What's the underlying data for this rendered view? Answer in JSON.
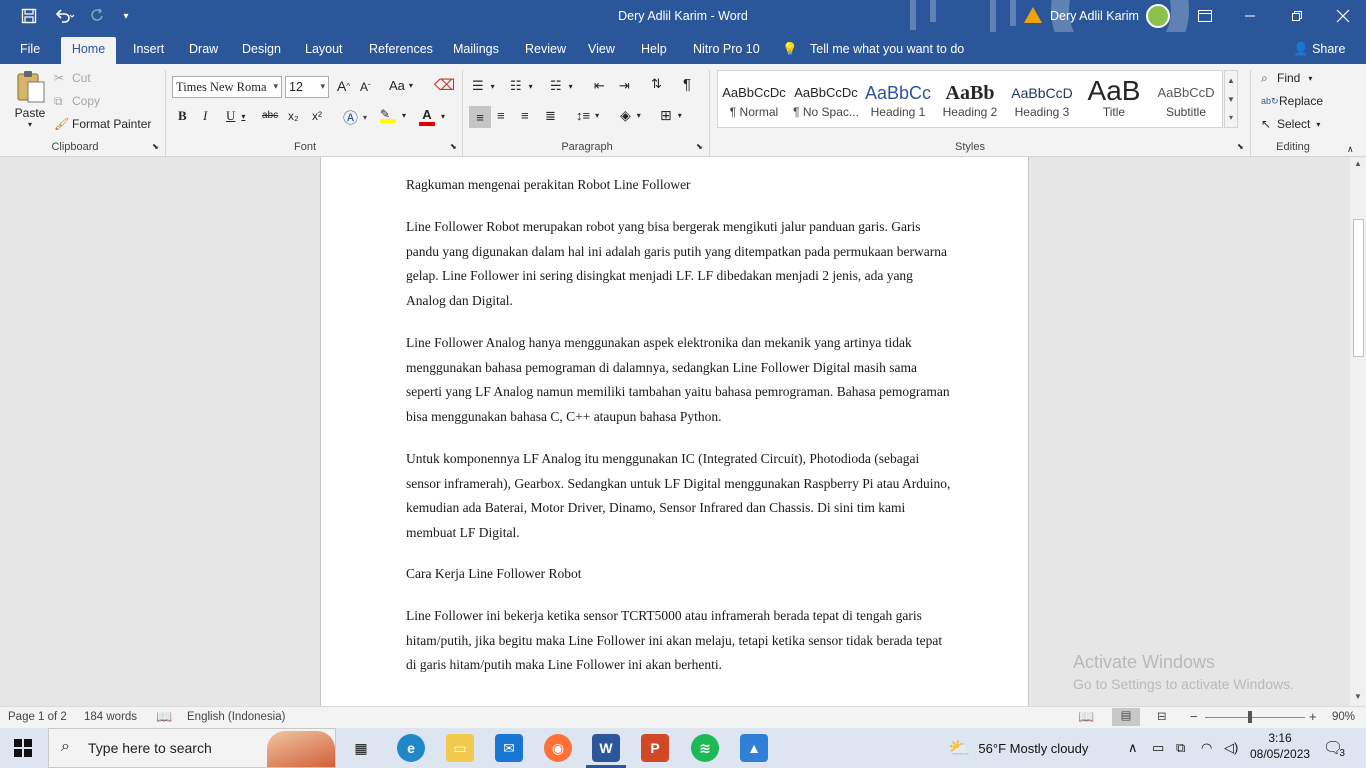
{
  "titlebar": {
    "title": "Dery Adlil Karim  -  Word",
    "user": "Dery Adlil Karim",
    "qat_icons": [
      "save-icon",
      "undo-icon",
      "redo-icon",
      "customize-icon"
    ]
  },
  "tabs": [
    "File",
    "Home",
    "Insert",
    "Draw",
    "Design",
    "Layout",
    "References",
    "Mailings",
    "Review",
    "View",
    "Help",
    "Nitro Pro 10"
  ],
  "active_tab": "Home",
  "tell_me": "Tell me what you want to do",
  "share": "Share",
  "clipboard": {
    "paste": "Paste",
    "cut": "Cut",
    "copy": "Copy",
    "format_painter": "Format Painter",
    "label": "Clipboard"
  },
  "font": {
    "family": "Times New Roma",
    "size": "12",
    "label": "Font",
    "bold": "B",
    "italic": "I",
    "underline": "U",
    "strike": "abc",
    "subscript": "x₂",
    "superscript": "x²",
    "grow": "A",
    "shrink": "A",
    "case": "Aa"
  },
  "paragraph": {
    "label": "Paragraph",
    "pilcrow": "¶"
  },
  "styles": {
    "label": "Styles",
    "items": [
      {
        "preview": "AaBbCcDc",
        "name": "¶ Normal"
      },
      {
        "preview": "AaBbCcDc",
        "name": "¶ No Spac..."
      },
      {
        "preview": "AaBbCc",
        "name": "Heading 1"
      },
      {
        "preview": "AaBb",
        "name": "Heading 2"
      },
      {
        "preview": "AaBbCcD",
        "name": "Heading 3"
      },
      {
        "preview": "AaB",
        "name": "Title"
      },
      {
        "preview": "AaBbCcD",
        "name": "Subtitle"
      }
    ]
  },
  "editing": {
    "label": "Editing",
    "find": "Find",
    "replace": "Replace",
    "select": "Select"
  },
  "document": {
    "paragraphs": [
      "Ragkuman mengenai perakitan Robot Line Follower",
      "Line Follower Robot merupakan robot yang bisa bergerak mengikuti jalur panduan garis. Garis pandu yang digunakan dalam hal ini adalah garis putih yang ditempatkan pada permukaan berwarna gelap. Line Follower ini sering disingkat menjadi LF. LF dibedakan menjadi 2 jenis, ada yang Analog dan Digital.",
      "Line Follower Analog hanya menggunakan aspek elektronika dan mekanik yang artinya tidak menggunakan bahasa pemograman di dalamnya, sedangkan Line Follower Digital masih sama seperti yang LF Analog namun memiliki tambahan yaitu bahasa pemrograman. Bahasa pemograman bisa menggunakan bahasa C, C++ ataupun bahasa Python.",
      "Untuk komponennya LF Analog itu menggunakan IC (Integrated Circuit), Photodioda (sebagai sensor inframerah), Gearbox. Sedangkan untuk LF Digital menggunakan Raspberry Pi atau Arduino, kemudian ada Baterai, Motor Driver, Dinamo, Sensor Infrared dan Chassis. Di sini tim kami membuat LF Digital.",
      "Cara Kerja Line Follower Robot",
      "Line Follower ini bekerja ketika sensor TCRT5000 atau inframerah berada tepat di tengah garis hitam/putih, jika begitu maka Line Follower ini akan melaju, tetapi ketika sensor tidak berada tepat di garis hitam/putih maka Line Follower ini akan berhenti."
    ]
  },
  "watermark": {
    "line1": "Activate Windows",
    "line2": "Go to Settings to activate Windows."
  },
  "statusbar": {
    "page": "Page 1 of 2",
    "words": "184 words",
    "language": "English (Indonesia)",
    "zoom": "90%"
  },
  "taskbar": {
    "search_placeholder": "Type here to search",
    "weather": "56°F  Mostly cloudy",
    "time": "3:16",
    "date": "08/05/2023",
    "notifications": "3",
    "apps": [
      "task-view",
      "edge",
      "file-explorer",
      "mail",
      "firefox",
      "word",
      "powerpoint",
      "spotify",
      "photos"
    ]
  }
}
